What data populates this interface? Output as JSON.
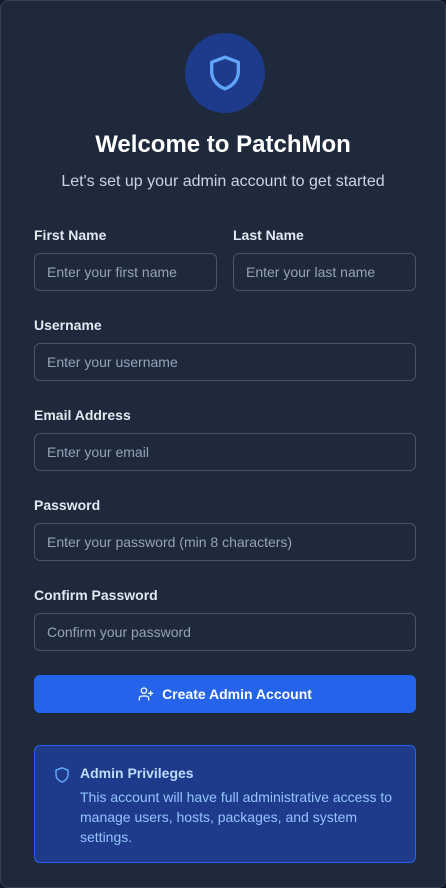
{
  "header": {
    "logo_icon": "shield-icon",
    "title": "Welcome to PatchMon",
    "subtitle": "Let's set up your admin account to get started"
  },
  "form": {
    "first_name": {
      "label": "First Name",
      "placeholder": "Enter your first name",
      "value": ""
    },
    "last_name": {
      "label": "Last Name",
      "placeholder": "Enter your last name",
      "value": ""
    },
    "username": {
      "label": "Username",
      "placeholder": "Enter your username",
      "value": ""
    },
    "email": {
      "label": "Email Address",
      "placeholder": "Enter your email",
      "value": ""
    },
    "password": {
      "label": "Password",
      "placeholder": "Enter your password (min 8 characters)",
      "value": ""
    },
    "confirm_password": {
      "label": "Confirm Password",
      "placeholder": "Confirm your password",
      "value": ""
    },
    "submit": {
      "label": "Create Admin Account",
      "icon": "user-plus-icon"
    }
  },
  "notice": {
    "icon": "shield-icon",
    "title": "Admin Privileges",
    "text": "This account will have full administrative access to manage users, hosts, packages, and system settings."
  },
  "colors": {
    "background": "#1e293b",
    "accent": "#2563eb",
    "notice_bg": "#1e3a8a",
    "notice_text": "#93c5fd"
  }
}
